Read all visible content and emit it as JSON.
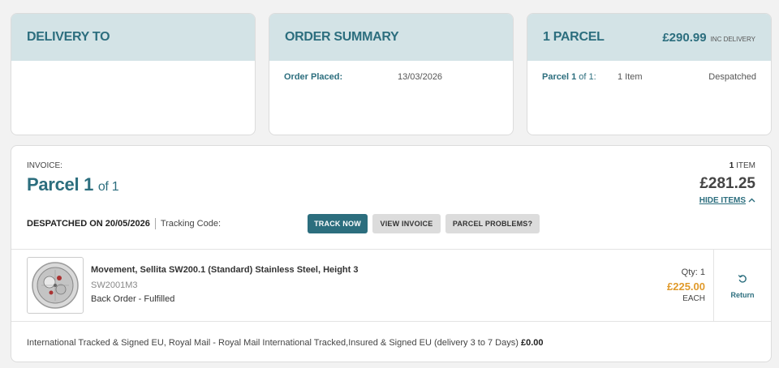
{
  "delivery": {
    "title": "DELIVERY TO"
  },
  "order": {
    "title": "ORDER SUMMARY",
    "placed_label": "Order Placed:",
    "placed_date": "13/03/2026"
  },
  "parcel_card": {
    "title": "1 PARCEL",
    "price": "£290.99",
    "price_note": "INC DELIVERY",
    "parcel_word": "Parcel",
    "parcel_num": "1",
    "parcel_of": "of 1:",
    "items": "1 Item",
    "status": "Despatched"
  },
  "invoice": {
    "label": "INVOICE:",
    "parcel_word": "Parcel",
    "parcel_num": "1",
    "parcel_of": "of 1",
    "item_count": "1",
    "item_word": "ITEM",
    "total": "£281.25",
    "hide_items": "HIDE ITEMS",
    "despatched": "DESPATCHED ON 20/05/2026",
    "tracking_label": "Tracking Code:",
    "buttons": {
      "track": "TRACK NOW",
      "view_invoice": "VIEW INVOICE",
      "problems": "PARCEL PROBLEMS?"
    }
  },
  "item": {
    "name": "Movement, Sellita SW200.1 (Standard) Stainless Steel, Height 3",
    "sku": "SW2001M3",
    "status": "Back Order - Fulfilled",
    "qty": "Qty: 1",
    "price": "£225.00",
    "each": "EACH",
    "return_label": "Return"
  },
  "shipping": {
    "text": "International Tracked & Signed EU, Royal Mail - Royal Mail International Tracked,Insured & Signed EU (delivery 3 to 7 Days)",
    "price": "£0.00"
  },
  "colors": {
    "accent": "#2c6e7e",
    "header_bg": "#d3e3e6",
    "price_orange": "#e09a2b"
  },
  "icons": {
    "return": "return-icon",
    "chevron": "chevron-up-icon",
    "product": "watch-movement-image"
  }
}
